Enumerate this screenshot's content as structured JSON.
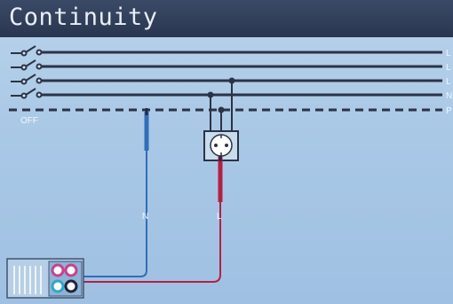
{
  "header": {
    "title": "Continuity"
  },
  "network": {
    "lines": [
      {
        "id": "line-1",
        "label": "L"
      },
      {
        "id": "line-2",
        "label": "L"
      },
      {
        "id": "line-3",
        "label": "L"
      },
      {
        "id": "line-n",
        "label": "N"
      },
      {
        "id": "line-pe",
        "label": "P"
      }
    ],
    "off_label": "OFF"
  },
  "test_leads": {
    "blue_lead_label": "N",
    "red_lead_label": "L"
  },
  "colors": {
    "background": "#a9c8e6",
    "title_bar": "#2f3a55",
    "line": "#2b3346",
    "blue_lead": "#2f6fb6",
    "red_lead": "#b51f45",
    "terminal_magenta": "#c4448f",
    "terminal_cyan": "#2da8c8"
  },
  "icons": [
    "switch-icon",
    "socket-outlet-icon",
    "instrument-terminals-icon"
  ]
}
